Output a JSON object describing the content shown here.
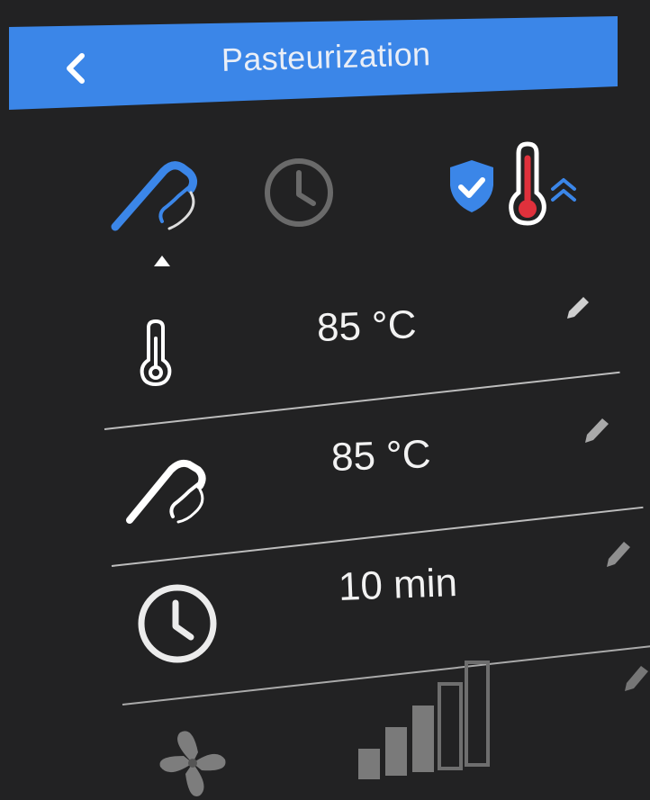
{
  "header": {
    "title": "Pasteurization",
    "back_icon": "chevron-left-icon"
  },
  "colors": {
    "accent": "#3b86e8",
    "background": "#222223",
    "warning_red": "#e0313c"
  },
  "modes": [
    {
      "icon": "steam-wand-icon",
      "selected": true
    },
    {
      "icon": "clock-icon",
      "selected": false
    },
    {
      "icon": "shield-check-icon",
      "selected": false
    },
    {
      "icon": "thermometer-rising-icon",
      "selected": false
    }
  ],
  "settings": [
    {
      "icon": "thermometer-icon",
      "value": "85 °C",
      "edit_icon": "pencil-icon"
    },
    {
      "icon": "steam-wand-icon",
      "value": "85 °C",
      "edit_icon": "pencil-icon"
    },
    {
      "icon": "clock-icon",
      "value": "10 min",
      "edit_icon": "pencil-icon"
    },
    {
      "icon": "fan-icon",
      "level": 3,
      "level_max": 5,
      "edit_icon": "pencil-icon"
    }
  ]
}
